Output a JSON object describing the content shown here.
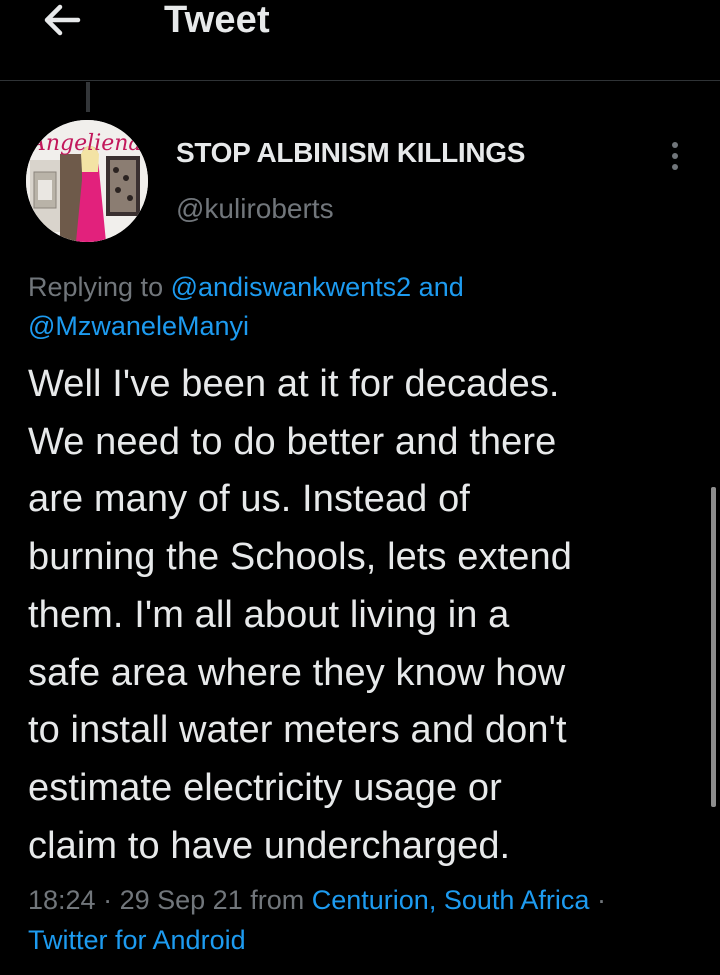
{
  "header": {
    "title": "Tweet",
    "back_icon": "arrow-left-icon"
  },
  "author": {
    "display_name": "STOP ALBINISM KILLINGS",
    "handle": "@kuliroberts",
    "avatar_text": "Angeliena",
    "more_icon": "more-vertical-icon"
  },
  "replying": {
    "prefix": "Replying to",
    "mention1": "@andiswankwents2",
    "conjunction": "and",
    "mention2": "@MzwaneleManyi"
  },
  "tweet": {
    "text": "Well I've been at it for decades.\nWe need to do better and there\nare many of us. Instead of\nburning the Schools, lets extend\nthem. I'm all about living in a\nsafe area where they know how\nto install water meters and don't\nestimate electricity usage or\nclaim to have undercharged."
  },
  "meta": {
    "time": "18:24",
    "sep1": "·",
    "date": "29 Sep 21",
    "from": "from",
    "location": "Centurion, South Africa",
    "sep2": "·",
    "client": "Twitter for Android"
  },
  "colors": {
    "background": "#000000",
    "text": "#e7e9ea",
    "secondary": "#71767b",
    "link": "#1d9bf0"
  }
}
